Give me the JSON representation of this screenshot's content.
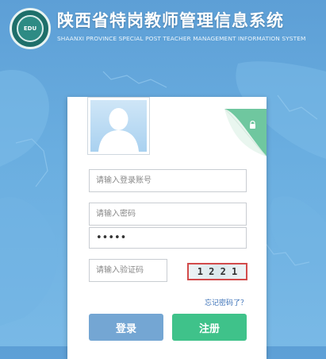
{
  "header": {
    "title_cn": "陕西省特岗教师管理信息系统",
    "title_en": "SHAANXI PROVINCE SPECIAL POST TEACHER MANAGEMENT INFORMATION SYSTEM",
    "logo_text": "EDU"
  },
  "form": {
    "account_placeholder": "请输入登录账号",
    "password_placeholder": "请输入密码",
    "password_value": "•••••",
    "captcha_placeholder": "请输入验证码",
    "captcha_code": "1 2 2 1",
    "forgot_label": "忘记密码了？",
    "login_label": "登录",
    "register_label": "注册"
  },
  "icons": {
    "avatar": "user-avatar-icon",
    "lock": "lock-icon"
  },
  "colors": {
    "background": "#6aaee0",
    "login_button": "#74a6d3",
    "register_button": "#3fc28a",
    "captcha_border": "#d24b4b",
    "link": "#3c72b8"
  }
}
